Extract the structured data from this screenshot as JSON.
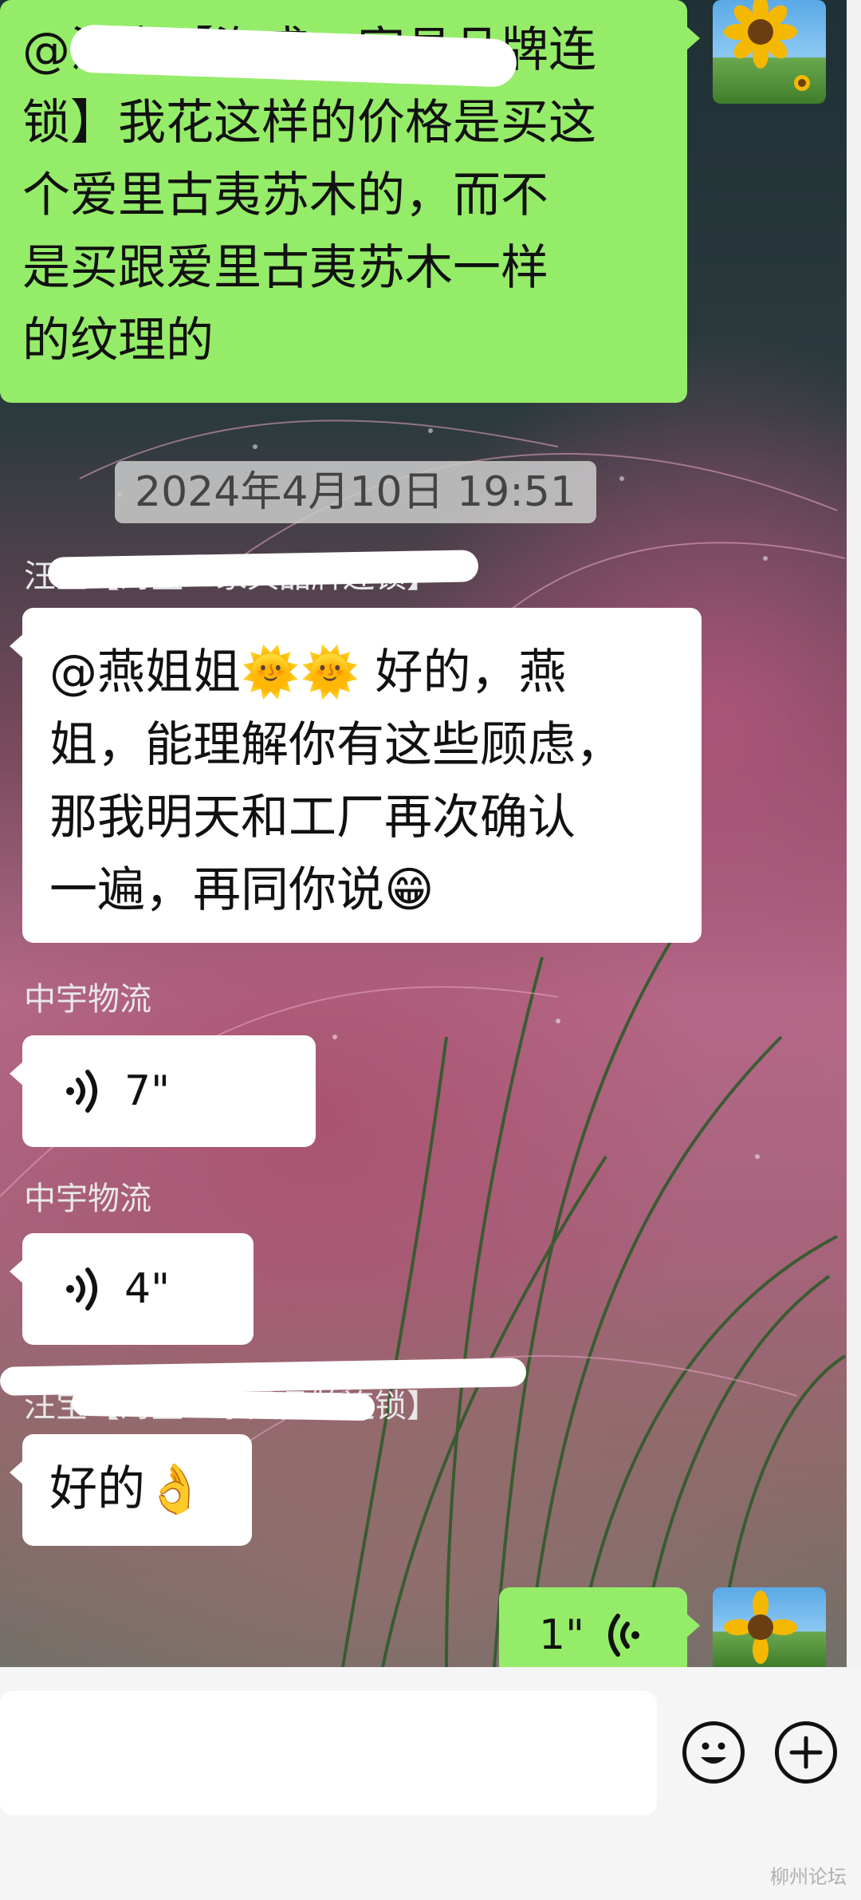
{
  "messages": {
    "m1_text": "@汪宝【海盛一家具品牌连锁】我花这样的价格是买这个爱里古夷苏木的，而不是买跟爱里古夷苏木一样的纹理的",
    "m1_lines": [
      "@汪宝【海盛一家具品牌连",
      "锁】我花这样的价格是买这",
      "个爱里古夷苏木的，而不",
      "是买跟爱里古夷苏木一样",
      "的纹理的"
    ],
    "timestamp": "2024年4月10日 19:51",
    "m2_sender": "汪宝【海盛一家具品牌连锁】",
    "m2_lines": [
      "@燕姐姐🌞🌞 好的，燕",
      "姐，能理解你有这些顾虑，",
      "那我明天和工厂再次确认",
      "一遍，再同你说😁"
    ],
    "m3_sender": "中宇物流",
    "m3_voice": "7\"",
    "m4_sender": "中宇物流",
    "m4_voice": "4\"",
    "m5_sender": "汪宝【海盛一家具品牌连锁】",
    "m5_text": "好的👌",
    "m6_voice": "1\""
  },
  "input": {
    "emoji_icon": "smiley-face",
    "plus_icon": "plus-circle"
  },
  "watermark": "柳州论坛",
  "colors": {
    "my_bubble": "#95ec69",
    "other_bubble": "#ffffff",
    "timestamp_bg": "#cdcdcd"
  }
}
